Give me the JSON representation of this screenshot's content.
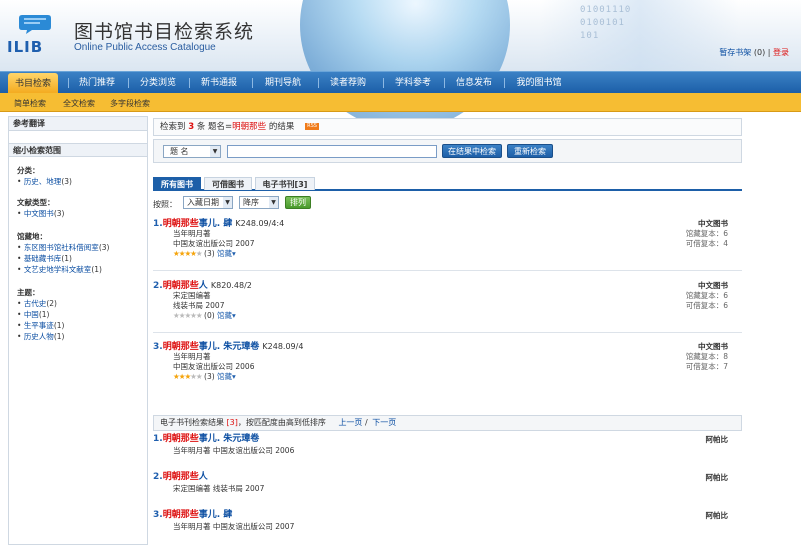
{
  "header": {
    "title_cn": "图书馆书目检索系统",
    "title_en": "Online Public Access Catalogue",
    "logo_text": "ILIB",
    "binary_deco": [
      "01001110",
      "0100101",
      "101"
    ],
    "shelf_link": "暂存书架",
    "shelf_count": "(0)",
    "divider": "|",
    "login": "登录"
  },
  "nav": {
    "items": [
      "书目检索",
      "热门推荐",
      "分类浏览",
      "新书通报",
      "期刊导航",
      "读者荐购",
      "学科参考",
      "信息发布",
      "我的图书馆"
    ],
    "active_index": 0
  },
  "subnav": [
    "简单检索",
    "全文检索",
    "多字段检索"
  ],
  "sidebar": {
    "ref_title": "参考翻译",
    "narrow_title": "缩小检索范围",
    "groups": [
      {
        "title": "分类：",
        "items": [
          {
            "name": "历史、地理",
            "count": "(3)"
          }
        ]
      },
      {
        "title": "文献类型：",
        "items": [
          {
            "name": "中文图书",
            "count": "(3)"
          }
        ]
      },
      {
        "title": "馆藏地：",
        "items": [
          {
            "name": "东区图书馆社科借阅室",
            "count": "(3)"
          },
          {
            "name": "基础藏书库",
            "count": "(1)"
          },
          {
            "name": "文艺史地学科文献室",
            "count": "(1)"
          }
        ]
      },
      {
        "title": "主题：",
        "items": [
          {
            "name": "古代史",
            "count": "(2)"
          },
          {
            "name": "中国",
            "count": "(1)"
          },
          {
            "name": "生平事迹",
            "count": "(1)"
          },
          {
            "name": "历史人物",
            "count": "(1)"
          }
        ]
      }
    ]
  },
  "result": {
    "prefix": "检索到",
    "count": "3",
    "mid": "条 题名=",
    "query": "明朝那些",
    "suffix": "的结果",
    "rss": "RSS"
  },
  "search": {
    "field": "题 名",
    "value": "",
    "btn_in_result": "在结果中检索",
    "btn_new": "重新检索"
  },
  "tabs": [
    {
      "label": "所有图书",
      "active": true
    },
    {
      "label": "可借图书",
      "active": false
    },
    {
      "label": "电子书刊[3]",
      "active": false
    }
  ],
  "sort": {
    "label": "按照：",
    "field": "入藏日期",
    "order": "降序",
    "button": "排列"
  },
  "records": [
    {
      "num": "1.",
      "title_hl": "明朝那些",
      "title_rest": "事儿. 肆",
      "call": "K248.09/4:4",
      "author": "当年明月著",
      "publisher": "中国友谊出版公司 2007",
      "stars": 4,
      "ratings": "(3)",
      "holdings": "馆藏",
      "type": "中文图书",
      "total": "馆藏复本：6",
      "avail": "可借复本：4"
    },
    {
      "num": "2.",
      "title_hl": "明朝那些",
      "title_rest": "人",
      "call": "K820.48/2",
      "author": "宋定国编著",
      "publisher": "线装书局 2007",
      "stars": 0,
      "ratings": "(0)",
      "holdings": "馆藏",
      "type": "中文图书",
      "total": "馆藏复本：6",
      "avail": "可借复本：6"
    },
    {
      "num": "3.",
      "title_hl": "明朝那些",
      "title_rest": "事儿. 朱元璋卷",
      "call": "K248.09/4",
      "author": "当年明月著",
      "publisher": "中国友谊出版公司 2006",
      "stars": 3,
      "ratings": "(3)",
      "holdings": "馆藏",
      "type": "中文图书",
      "total": "馆藏复本：8",
      "avail": "可借复本：7"
    }
  ],
  "ebooks": {
    "prefix": "电子书刊检索结果",
    "count": "[3]",
    "suffix": "，按匹配度由高到低排序",
    "prev": "上一页",
    "sep": "/",
    "next": "下一页",
    "items": [
      {
        "num": "1.",
        "title_hl": "明朝那些",
        "title_rest": "事儿. 朱元璋卷",
        "meta": "当年明月著 中国友谊出版公司 2006",
        "source": "阿帕比"
      },
      {
        "num": "2.",
        "title_hl": "明朝那些",
        "title_rest": "人",
        "meta": "宋定国编著 线装书局 2007",
        "source": "阿帕比"
      },
      {
        "num": "3.",
        "title_hl": "明朝那些",
        "title_rest": "事儿. 肆",
        "meta": "当年明月著 中国友谊出版公司 2007",
        "source": "阿帕比"
      }
    ]
  },
  "colors": {
    "accent_blue": "#1d5fa8",
    "nav_active": "#f3a91c",
    "highlight_red": "#dd1111",
    "star": "#f5a40c"
  }
}
